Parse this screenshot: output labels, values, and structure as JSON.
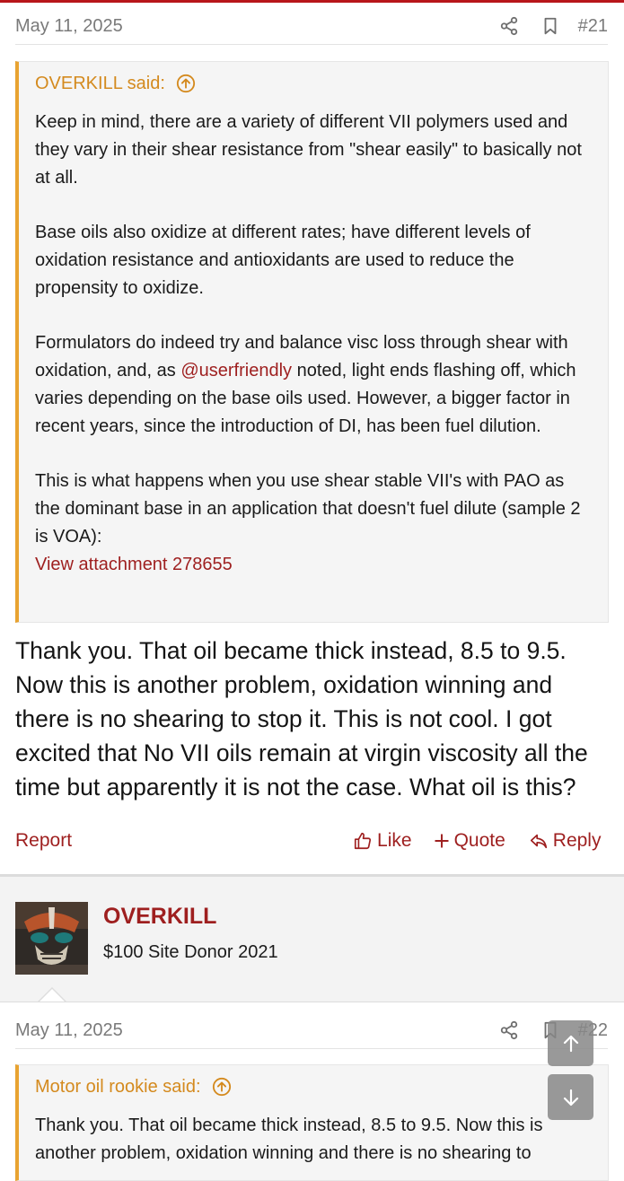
{
  "post21": {
    "date": "May 11, 2025",
    "number": "#21",
    "quote": {
      "author": "OVERKILL said:",
      "paragraphs": [
        "Keep in mind, there are a variety of different VII polymers used and they vary in their shear resistance from \"shear easily\" to basically not at all.",
        "Base oils also oxidize at different rates; have different levels of oxidation resistance and antioxidants are used to reduce the propensity to oxidize.",
        "This is what happens when you use shear stable VII's with PAO as the dominant base in an application that doesn't fuel dilute (sample 2 is VOA):"
      ],
      "p3_before": "Formulators do indeed try and balance visc loss through shear with oxidation, and, as ",
      "p3_mention": "@userfriendly",
      "p3_after": " noted, light ends flashing off, which varies depending on the base oils used. However, a bigger factor in recent years, since the introduction of DI, has been fuel dilution.",
      "attachment": "View attachment 278655"
    },
    "text": "Thank you. That oil became thick instead, 8.5 to 9.5. Now this is another problem, oxidation winning and there is no shearing to stop it. This is not cool. I got excited that No VII oils remain at virgin viscosity all the time but apparently it is not the case. What oil is this?",
    "actions": {
      "report": "Report",
      "like": "Like",
      "quote": "Quote",
      "reply": "Reply"
    }
  },
  "post22": {
    "username": "OVERKILL",
    "user_title": "$100 Site Donor 2021",
    "date": "May 11, 2025",
    "number": "#22",
    "quote": {
      "author": "Motor oil rookie said:",
      "text": "Thank you. That oil became thick instead, 8.5 to 9.5. Now this is another problem, oxidation winning and there is no shearing to"
    }
  },
  "icons": [
    "share-icon",
    "bookmark-icon",
    "quote-jump-icon",
    "thumbs-up-icon",
    "plus-icon",
    "reply-icon",
    "arrow-up-icon",
    "arrow-down-icon"
  ],
  "colors": {
    "accent": "#9e1f1f",
    "quote_bar": "#e8a331",
    "quote_author": "#d48a1e"
  }
}
